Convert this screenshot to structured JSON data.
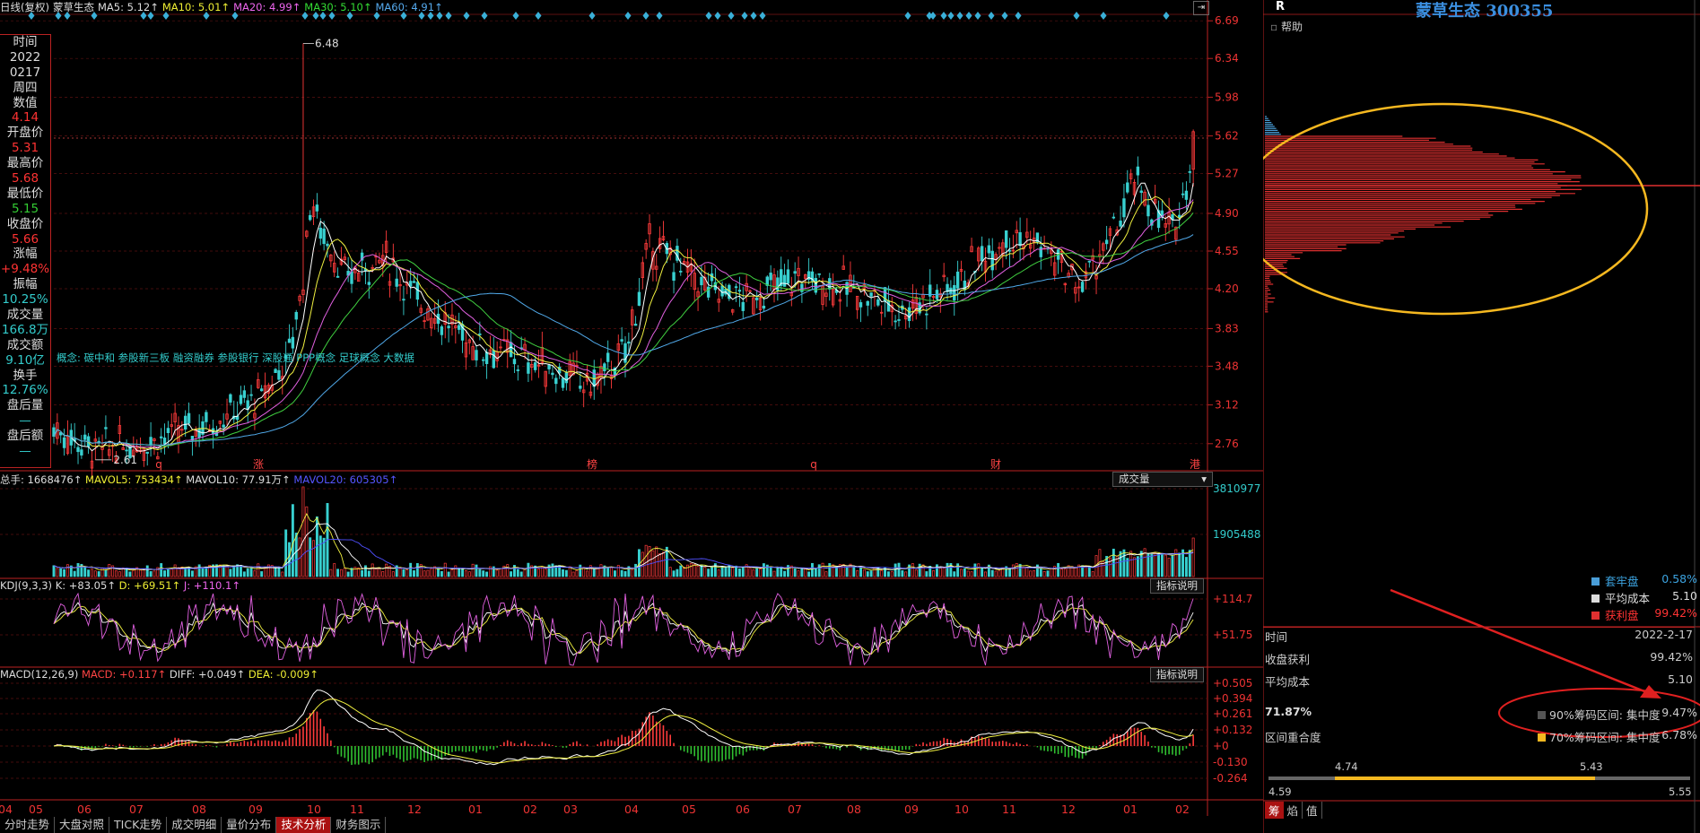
{
  "header": {
    "period": "日线(复权)",
    "stock_name": "蒙草生态",
    "ma5": "MA5: 5.12↑",
    "ma10": "MA10: 5.01↑",
    "ma20": "MA20: 4.99↑",
    "ma30": "MA30: 5.10↑",
    "ma60": "MA60: 4.91↑"
  },
  "info_box": [
    {
      "label": "时间",
      "value": "2022",
      "value2": "0217"
    },
    {
      "label": "周四",
      "value": ""
    },
    {
      "label": "数值",
      "value": "4.14"
    },
    {
      "label": "开盘价",
      "value": "5.31"
    },
    {
      "label": "最高价",
      "value": "5.68"
    },
    {
      "label": "最低价",
      "value": "5.15"
    },
    {
      "label": "收盘价",
      "value": "5.66"
    },
    {
      "label": "涨幅",
      "value": "+9.48%"
    },
    {
      "label": "振幅",
      "value": "10.25%"
    },
    {
      "label": "成交量",
      "value": "166.8万"
    },
    {
      "label": "成交额",
      "value": "9.10亿"
    },
    {
      "label": "换手",
      "value": "12.76%"
    },
    {
      "label": "盘后量",
      "value": "—"
    },
    {
      "label": "盘后额",
      "value": "—"
    }
  ],
  "info_text": {
    "time_label": "时间",
    "time_year": "2022",
    "time_md": "0217",
    "weekday": "周四",
    "val_label": "数值",
    "val": "4.14",
    "open_label": "开盘价",
    "open": "5.31",
    "high_label": "最高价",
    "high": "5.68",
    "low_label": "最低价",
    "low": "5.15",
    "close_label": "收盘价",
    "close": "5.66",
    "chg_label": "涨幅",
    "chg": "+9.48%",
    "amp_label": "振幅",
    "amp": "10.25%",
    "vol_label": "成交量",
    "vol": "166.8万",
    "amt_label": "成交额",
    "amt": "9.10亿",
    "turn_label": "换手",
    "turn": "12.76%",
    "ah_vol_label": "盘后量",
    "ah_vol": "—",
    "ah_amt_label": "盘后额",
    "ah_amt": "—"
  },
  "price_axis": [
    "6.69",
    "6.34",
    "5.98",
    "5.62",
    "5.27",
    "4.90",
    "4.55",
    "4.20",
    "3.83",
    "3.48",
    "3.12",
    "2.76"
  ],
  "price_annotations": {
    "high": "6.48",
    "low": "2.61"
  },
  "concept_text": "概念: 碳中和 参股新三板 融资融券 参股银行 深股通 PPP概念 足球概念 大数据",
  "event_markers": [
    "q",
    "涨",
    "榜",
    "q",
    "财",
    "港"
  ],
  "volume_panel": {
    "title_total": "总手: 1668476↑",
    "mavol5": "MAVOL5: 753434↑",
    "mavol10": "MAVOL10: 77.91万↑",
    "mavol20": "MAVOL20: 605305↑",
    "selector": "成交量",
    "axis": [
      "3810977",
      "1905488"
    ]
  },
  "kdj_panel": {
    "title": "KDJ(9,3,3)",
    "k": "K: +83.05↑",
    "d": "D: +69.51↑",
    "j": "J: +110.1↑",
    "btn": "指标说明",
    "axis": [
      "+114.7",
      "+51.75"
    ]
  },
  "macd_panel": {
    "title": "MACD(12,26,9)",
    "macd": "MACD: +0.117↑",
    "diff": "DIFF: +0.049↑",
    "dea": "DEA: -0.009↑",
    "btn": "指标说明",
    "axis": [
      "+0.505",
      "+0.394",
      "+0.261",
      "+0.132",
      "+0",
      "-0.130",
      "-0.264"
    ]
  },
  "months": [
    "04",
    "05",
    "06",
    "07",
    "08",
    "09",
    "10",
    "11",
    "12",
    "01",
    "02",
    "03",
    "04",
    "05",
    "06",
    "07",
    "08",
    "09",
    "10",
    "11",
    "12",
    "01",
    "02"
  ],
  "bottom_tabs": [
    "分时走势",
    "大盘对照",
    "TICK走势",
    "成交明细",
    "量价分布",
    "技术分析",
    "财务图示"
  ],
  "active_tab": "技术分析",
  "right_panel": {
    "r_label": "R",
    "title": "蒙草生态 300355",
    "help": "帮助",
    "legend": [
      {
        "label": "套牢盘",
        "value": "0.58%",
        "color": "#4a9ed8"
      },
      {
        "label": "平均成本",
        "value": "5.10",
        "color": "#dddddd"
      },
      {
        "label": "获利盘",
        "value": "99.42%",
        "color": "#e03030"
      }
    ],
    "stats": [
      {
        "label": "时间",
        "value": "2022-2-17"
      },
      {
        "label": "收盘获利",
        "value": "99.42%"
      },
      {
        "label": "平均成本",
        "value": "5.10"
      }
    ],
    "overlap_pct": "71.87%",
    "overlap_label": "区间重合度",
    "range90": {
      "label": "90%筹码区间: 集中度",
      "value": "9.47%",
      "color": "#555555"
    },
    "range70": {
      "label": "70%筹码区间: 集中度",
      "value": "6.78%",
      "color": "#f5b820"
    },
    "range_bar": {
      "low90": "4.59",
      "low70": "4.74",
      "high70": "5.43",
      "high90": "5.55"
    },
    "tabs": [
      "筹",
      "焰",
      "值"
    ]
  },
  "colors": {
    "up": "#ff3333",
    "down": "#33cccc",
    "ellipse": "#f5b820",
    "arrow": "#e02020"
  }
}
